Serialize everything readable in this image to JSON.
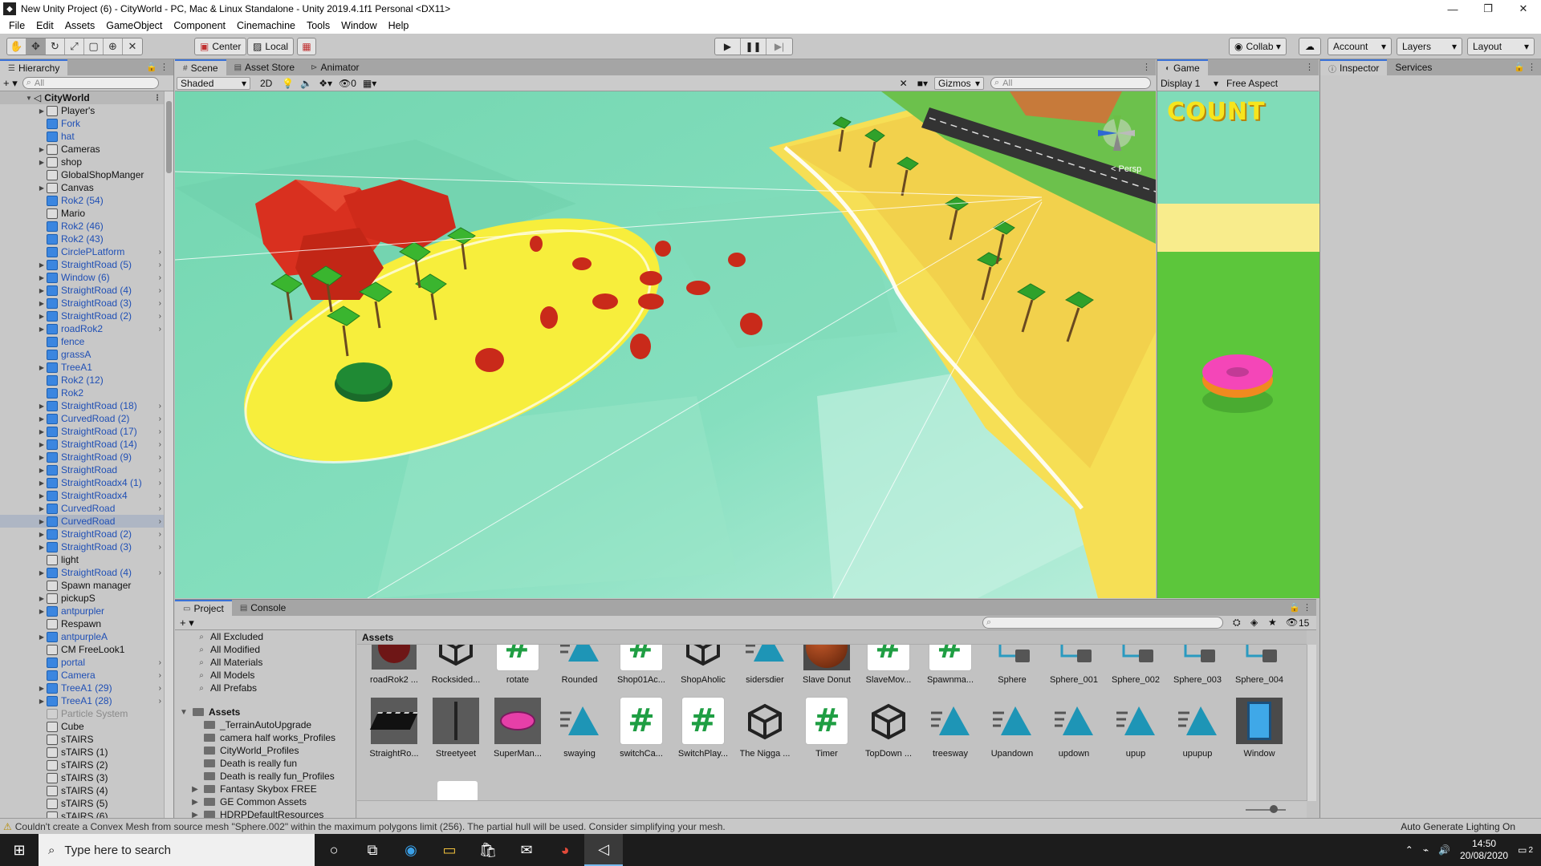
{
  "window": {
    "title": "New Unity Project (6) - CityWorld - PC, Mac & Linux Standalone - Unity 2019.4.1f1 Personal <DX11>",
    "controls": [
      "—",
      "❐",
      "✕"
    ]
  },
  "menu": [
    "File",
    "Edit",
    "Assets",
    "GameObject",
    "Component",
    "Cinemachine",
    "Tools",
    "Window",
    "Help"
  ],
  "toolbar": {
    "pivot": "Center",
    "space": "Local",
    "collab": "Collab ▾",
    "account": "Account",
    "layers": "Layers",
    "layout": "Layout",
    "play_icon": "▶",
    "pause_icon": "❚❚",
    "step_icon": "▶|"
  },
  "hierarchy": {
    "tab": "Hierarchy",
    "add": "+ ▾",
    "search_placeholder": "All",
    "root": "CityWorld",
    "items": [
      {
        "label": "Player's",
        "color": "grey",
        "arrow": true
      },
      {
        "label": "Fork",
        "color": "blue",
        "arrow": false
      },
      {
        "label": "hat",
        "color": "blue",
        "arrow": false
      },
      {
        "label": "Cameras",
        "color": "grey",
        "arrow": true
      },
      {
        "label": "shop",
        "color": "grey",
        "arrow": true
      },
      {
        "label": "GlobalShopManger",
        "color": "grey",
        "arrow": false
      },
      {
        "label": "Canvas",
        "color": "grey",
        "arrow": true
      },
      {
        "label": "Rok2 (54)",
        "color": "blue",
        "arrow": false
      },
      {
        "label": "Mario",
        "color": "grey",
        "arrow": false
      },
      {
        "label": "Rok2 (46)",
        "color": "blue",
        "arrow": false
      },
      {
        "label": "Rok2 (43)",
        "color": "blue",
        "arrow": false
      },
      {
        "label": "CirclePLatform",
        "color": "blue",
        "arrow": false,
        "more": true
      },
      {
        "label": "StraightRoad (5)",
        "color": "blue",
        "arrow": true,
        "more": true
      },
      {
        "label": "Window (6)",
        "color": "blue",
        "arrow": true,
        "more": true
      },
      {
        "label": "StraightRoad (4)",
        "color": "blue",
        "arrow": true,
        "more": true
      },
      {
        "label": "StraightRoad (3)",
        "color": "blue",
        "arrow": true,
        "more": true
      },
      {
        "label": "StraightRoad (2)",
        "color": "blue",
        "arrow": true,
        "more": true
      },
      {
        "label": "roadRok2",
        "color": "blue",
        "arrow": true,
        "more": true
      },
      {
        "label": "fence",
        "color": "blue",
        "arrow": false
      },
      {
        "label": "grassA",
        "color": "blue",
        "arrow": false
      },
      {
        "label": "TreeA1",
        "color": "blue",
        "arrow": true
      },
      {
        "label": "Rok2 (12)",
        "color": "blue",
        "arrow": false
      },
      {
        "label": "Rok2",
        "color": "blue",
        "arrow": false
      },
      {
        "label": "StraightRoad (18)",
        "color": "blue",
        "arrow": true,
        "more": true
      },
      {
        "label": "CurvedRoad (2)",
        "color": "blue",
        "arrow": true,
        "more": true
      },
      {
        "label": "StraightRoad (17)",
        "color": "blue",
        "arrow": true,
        "more": true
      },
      {
        "label": "StraightRoad (14)",
        "color": "blue",
        "arrow": true,
        "more": true
      },
      {
        "label": "StraightRoad (9)",
        "color": "blue",
        "arrow": true,
        "more": true
      },
      {
        "label": "StraightRoad",
        "color": "blue",
        "arrow": true,
        "more": true
      },
      {
        "label": "StraightRoadx4 (1)",
        "color": "blue",
        "arrow": true,
        "more": true
      },
      {
        "label": "StraightRoadx4",
        "color": "blue",
        "arrow": true,
        "more": true
      },
      {
        "label": "CurvedRoad",
        "color": "blue",
        "arrow": true,
        "more": true
      },
      {
        "label": "CurvedRoad",
        "color": "blue",
        "arrow": true,
        "more": true,
        "selected": true
      },
      {
        "label": "StraightRoad (2)",
        "color": "blue",
        "arrow": true,
        "more": true
      },
      {
        "label": "StraightRoad (3)",
        "color": "blue",
        "arrow": true,
        "more": true
      },
      {
        "label": "light",
        "color": "grey",
        "arrow": false
      },
      {
        "label": "StraightRoad (4)",
        "color": "blue",
        "arrow": true,
        "more": true
      },
      {
        "label": "Spawn manager",
        "color": "grey",
        "arrow": false
      },
      {
        "label": "pickupS",
        "color": "grey",
        "arrow": true
      },
      {
        "label": "antpurpler",
        "color": "blue",
        "arrow": true
      },
      {
        "label": "Respawn",
        "color": "grey",
        "arrow": false
      },
      {
        "label": "antpurpleA",
        "color": "blue",
        "arrow": true
      },
      {
        "label": "CM FreeLook1",
        "color": "grey",
        "arrow": false
      },
      {
        "label": "portal",
        "color": "blue",
        "arrow": false,
        "more": true
      },
      {
        "label": "Camera",
        "color": "blue",
        "arrow": false,
        "more": true
      },
      {
        "label": "TreeA1 (29)",
        "color": "blue",
        "arrow": true,
        "more": true
      },
      {
        "label": "TreeA1 (28)",
        "color": "blue",
        "arrow": true,
        "more": true
      },
      {
        "label": "Particle System",
        "color": "dim",
        "arrow": false
      },
      {
        "label": "Cube",
        "color": "grey",
        "arrow": false
      },
      {
        "label": "sTAIRS",
        "color": "grey",
        "arrow": false
      },
      {
        "label": "sTAIRS (1)",
        "color": "grey",
        "arrow": false
      },
      {
        "label": "sTAIRS (2)",
        "color": "grey",
        "arrow": false
      },
      {
        "label": "sTAIRS (3)",
        "color": "grey",
        "arrow": false
      },
      {
        "label": "sTAIRS (4)",
        "color": "grey",
        "arrow": false
      },
      {
        "label": "sTAIRS (5)",
        "color": "grey",
        "arrow": false
      },
      {
        "label": "sTAIRS (6)",
        "color": "grey",
        "arrow": false
      }
    ]
  },
  "scene": {
    "tabs": [
      {
        "label": "Scene",
        "icon": "#"
      },
      {
        "label": "Asset Store",
        "icon": "▤"
      },
      {
        "label": "Animator",
        "icon": "⊳"
      }
    ],
    "shading": "Shaded",
    "mode2d": "2D",
    "gizmos": "Gizmos",
    "hidden_count": "0",
    "search_placeholder": "All",
    "persp": "< Persp"
  },
  "game": {
    "tab": "Game",
    "display": "Display 1",
    "aspect": "Free Aspect",
    "count_text": "COUNT"
  },
  "inspector": {
    "tabs": [
      "Inspector",
      "Services"
    ]
  },
  "project": {
    "tabs": [
      "Project",
      "Console"
    ],
    "add": "+ ▾",
    "hidden_count": "15",
    "favorites": [
      "All Excluded",
      "All Modified",
      "All Materials",
      "All Models",
      "All Prefabs"
    ],
    "assets_root": "Assets",
    "folders": [
      "_TerrainAutoUpgrade",
      "camera half works_Profiles",
      "CityWorld_Profiles",
      "Death is really fun",
      "Death is really fun_Profiles",
      "Fantasy Skybox FREE",
      "GE Common Assets",
      "HDRPDefaultResources"
    ],
    "folders_expandable": [
      false,
      false,
      false,
      false,
      false,
      true,
      true,
      true
    ],
    "breadcrumb": "Assets",
    "row1": [
      {
        "label": "roadRok2 ...",
        "kind": "rock"
      },
      {
        "label": "Rocksided...",
        "kind": "unity"
      },
      {
        "label": "rotate",
        "kind": "hash"
      },
      {
        "label": "Rounded",
        "kind": "anim"
      },
      {
        "label": "Shop01Ac...",
        "kind": "hash"
      },
      {
        "label": "ShopAholic",
        "kind": "unity"
      },
      {
        "label": "sidersdier",
        "kind": "anim"
      },
      {
        "label": "Slave Donut",
        "kind": "ball"
      },
      {
        "label": "SlaveMov...",
        "kind": "hash"
      },
      {
        "label": "Spawnma...",
        "kind": "hash"
      },
      {
        "label": "Sphere",
        "kind": "mesh"
      },
      {
        "label": "Sphere_001",
        "kind": "mesh"
      },
      {
        "label": "Sphere_002",
        "kind": "mesh"
      },
      {
        "label": "Sphere_003",
        "kind": "mesh"
      },
      {
        "label": "Sphere_004",
        "kind": "mesh"
      }
    ],
    "row2": [
      {
        "label": "StraightRo...",
        "kind": "road"
      },
      {
        "label": "Streetyeet",
        "kind": "pole"
      },
      {
        "label": "SuperMan...",
        "kind": "donut"
      },
      {
        "label": "swaying",
        "kind": "anim"
      },
      {
        "label": "switchCa...",
        "kind": "hash"
      },
      {
        "label": "SwitchPlay...",
        "kind": "hash"
      },
      {
        "label": "The Nigga ...",
        "kind": "unity"
      },
      {
        "label": "Timer",
        "kind": "hash"
      },
      {
        "label": "TopDown ...",
        "kind": "unity"
      },
      {
        "label": "treesway",
        "kind": "anim"
      },
      {
        "label": "Upandown",
        "kind": "anim"
      },
      {
        "label": "updown",
        "kind": "anim"
      },
      {
        "label": "upup",
        "kind": "anim"
      },
      {
        "label": "upupup",
        "kind": "anim"
      },
      {
        "label": "Window",
        "kind": "window"
      }
    ]
  },
  "status": {
    "message": "Couldn't create a Convex Mesh from source mesh \"Sphere.002\" within the maximum polygons limit (256). The partial hull will be used. Consider simplifying your mesh.",
    "right": "Auto Generate Lighting On"
  },
  "taskbar": {
    "search_placeholder": "Type here to search",
    "time": "14:50",
    "date": "20/08/2020",
    "notif": "2"
  }
}
